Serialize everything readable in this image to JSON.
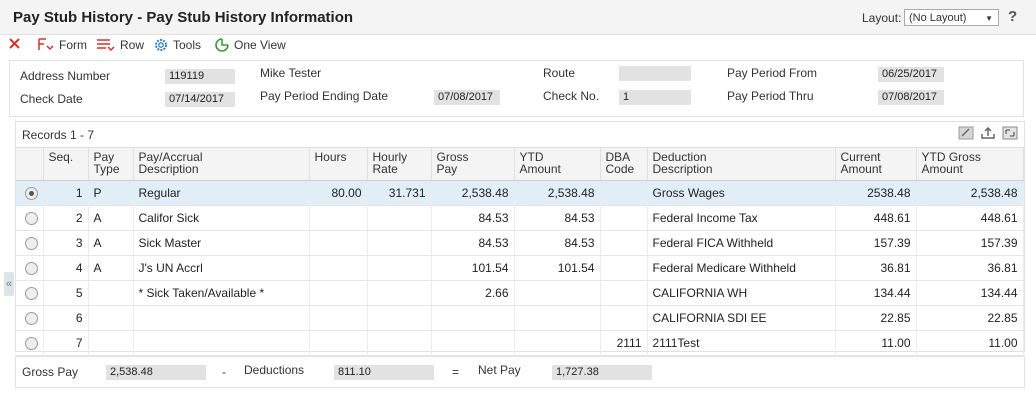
{
  "window": {
    "title": "Pay Stub History - Pay Stub History Information"
  },
  "layout": {
    "label": "Layout:",
    "value": "(No Layout)"
  },
  "help_label": "?",
  "toolbar": {
    "form_label": "Form",
    "row_label": "Row",
    "tools_label": "Tools",
    "oneview_label": "One View"
  },
  "header": {
    "address_number_label": "Address Number",
    "address_number_value": "119119",
    "name_value": "Mike Tester",
    "route_label": "Route",
    "route_value": "",
    "pay_period_from_label": "Pay Period From",
    "pay_period_from_value": "06/25/2017",
    "check_date_label": "Check Date",
    "check_date_value": "07/14/2017",
    "pay_period_ending_label": "Pay Period Ending Date",
    "pay_period_ending_value": "07/08/2017",
    "check_no_label": "Check No.",
    "check_no_value": "1",
    "pay_period_thru_label": "Pay Period Thru",
    "pay_period_thru_value": "07/08/2017"
  },
  "grid": {
    "records_label": "Records 1 - 7",
    "columns": {
      "seq": "Seq.",
      "pay_type_1": "Pay",
      "pay_type_2": "Type",
      "desc_1": "Pay/Accrual",
      "desc_2": "Description",
      "hours": "Hours",
      "rate_1": "Hourly",
      "rate_2": "Rate",
      "gross_1": "Gross",
      "gross_2": "Pay",
      "ytd_1": "YTD",
      "ytd_2": "Amount",
      "dba_1": "DBA",
      "dba_2": "Code",
      "ded_1": "Deduction",
      "ded_2": "Description",
      "cur_1": "Current",
      "cur_2": "Amount",
      "ytdg_1": "YTD Gross",
      "ytdg_2": "Amount"
    },
    "rows": [
      {
        "seq": "1",
        "pay_type": "P",
        "desc": "Regular",
        "hours": "80.00",
        "rate": "31.731",
        "gross": "2,538.48",
        "ytd": "2,538.48",
        "dba": "",
        "ded_desc": "Gross Wages",
        "current": "2538.48",
        "ytd_gross": "2,538.48"
      },
      {
        "seq": "2",
        "pay_type": "A",
        "desc": "Califor Sick",
        "hours": "",
        "rate": "",
        "gross": "84.53",
        "ytd": "84.53",
        "dba": "",
        "ded_desc": "Federal Income Tax",
        "current": "448.61",
        "ytd_gross": "448.61"
      },
      {
        "seq": "3",
        "pay_type": "A",
        "desc": "Sick Master",
        "hours": "",
        "rate": "",
        "gross": "84.53",
        "ytd": "84.53",
        "dba": "",
        "ded_desc": "Federal FICA Withheld",
        "current": "157.39",
        "ytd_gross": "157.39"
      },
      {
        "seq": "4",
        "pay_type": "A",
        "desc": "J's UN Accrl",
        "hours": "",
        "rate": "",
        "gross": "101.54",
        "ytd": "101.54",
        "dba": "",
        "ded_desc": "Federal Medicare Withheld",
        "current": "36.81",
        "ytd_gross": "36.81"
      },
      {
        "seq": "5",
        "pay_type": "",
        "desc": "* Sick Taken/Available *",
        "hours": "",
        "rate": "",
        "gross": "2.66",
        "ytd": "",
        "dba": "",
        "ded_desc": "CALIFORNIA WH",
        "current": "134.44",
        "ytd_gross": "134.44"
      },
      {
        "seq": "6",
        "pay_type": "",
        "desc": "",
        "hours": "",
        "rate": "",
        "gross": "",
        "ytd": "",
        "dba": "",
        "ded_desc": "CALIFORNIA SDI EE",
        "current": "22.85",
        "ytd_gross": "22.85"
      },
      {
        "seq": "7",
        "pay_type": "",
        "desc": "",
        "hours": "",
        "rate": "",
        "gross": "",
        "ytd": "",
        "dba": "2111",
        "ded_desc": "2111Test",
        "current": "11.00",
        "ytd_gross": "11.00"
      }
    ]
  },
  "footer": {
    "gross_pay_label": "Gross Pay",
    "gross_pay_value": "2,538.48",
    "minus": "-",
    "deductions_label": "Deductions",
    "deductions_value": "811.10",
    "equals": "=",
    "net_pay_label": "Net Pay",
    "net_pay_value": "1,727.38"
  },
  "side_handle": "«",
  "colors": {
    "accent_red": "#d9302c",
    "icon_blue": "#2f7fc1",
    "icon_green": "#3a9a3a",
    "selected_row": "#e1edf7",
    "field_bg": "#e2e2e2"
  }
}
